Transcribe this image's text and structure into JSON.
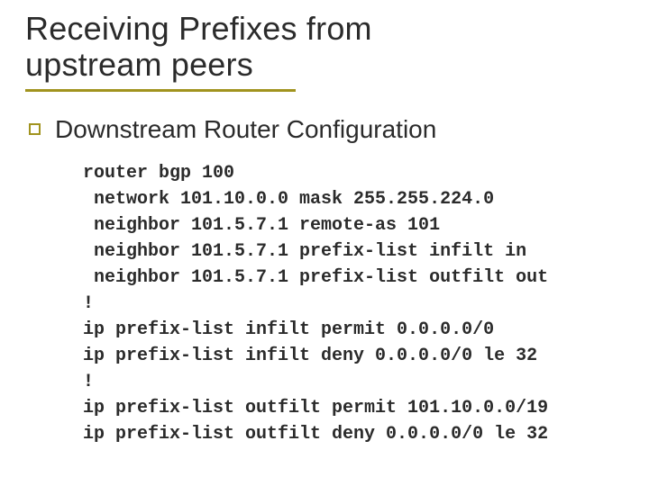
{
  "title_line1": "Receiving Prefixes from",
  "title_line2": "upstream peers",
  "subtitle": "Downstream Router Configuration",
  "code": {
    "l1": "router bgp 100",
    "l2": " network 101.10.0.0 mask 255.255.224.0",
    "l3": " neighbor 101.5.7.1 remote-as 101",
    "l4": " neighbor 101.5.7.1 prefix-list infilt in",
    "l5": " neighbor 101.5.7.1 prefix-list outfilt out",
    "l6": "!",
    "l7": "ip prefix-list infilt permit 0.0.0.0/0",
    "l8": "ip prefix-list infilt deny 0.0.0.0/0 le 32",
    "l9": "!",
    "l10": "ip prefix-list outfilt permit 101.10.0.0/19",
    "l11": "ip prefix-list outfilt deny 0.0.0.0/0 le 32"
  }
}
